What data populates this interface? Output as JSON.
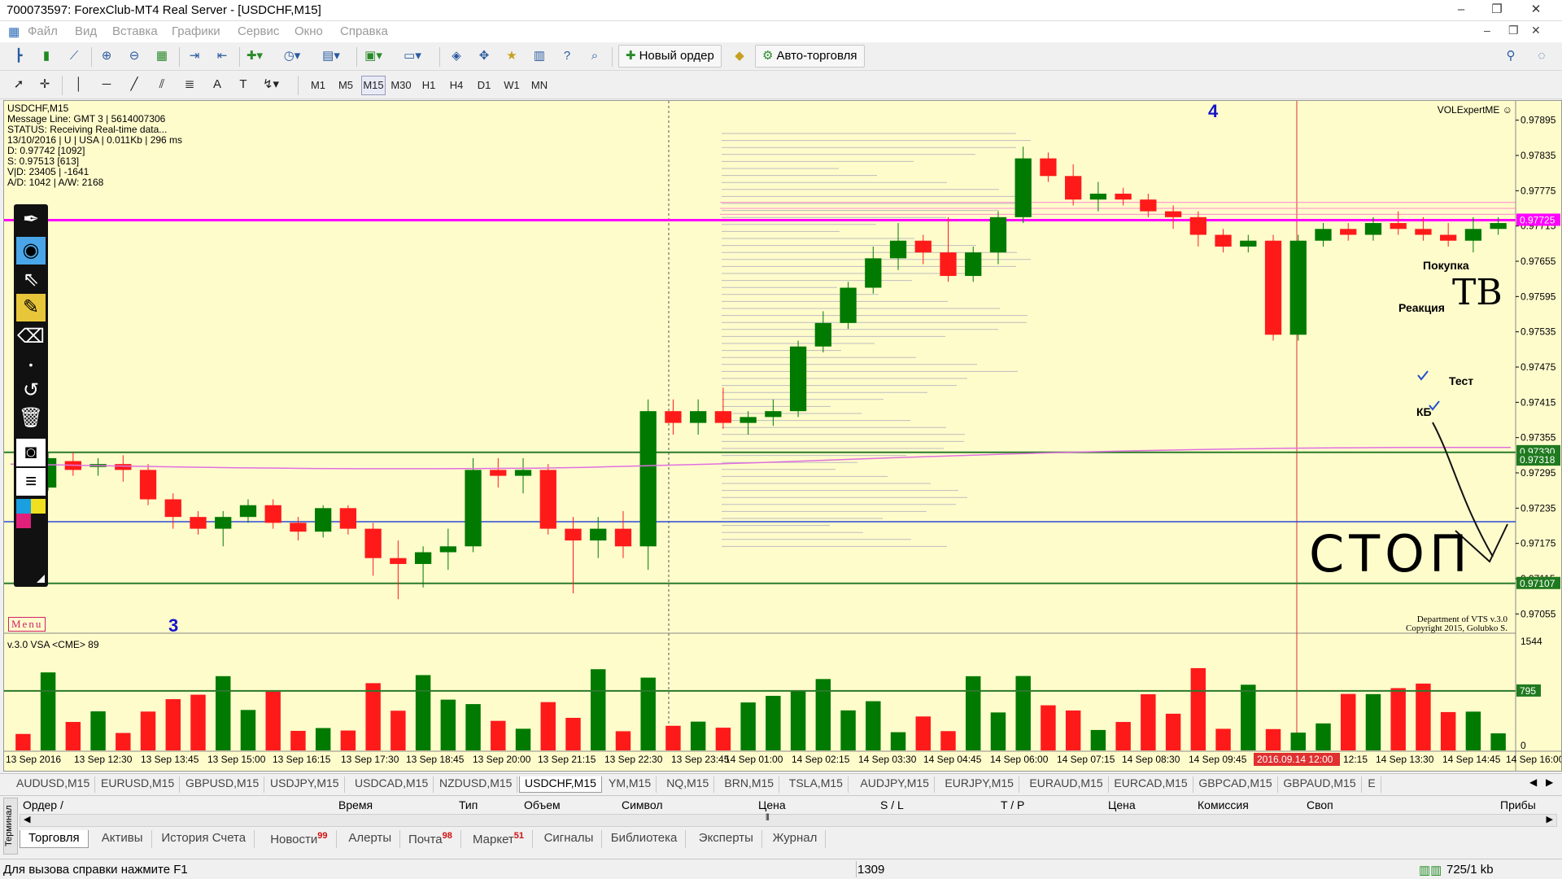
{
  "window": {
    "title": "700073597: ForexClub-MT4 Real Server - [USDCHF,M15]",
    "minimize": "–",
    "restore": "❐",
    "close": "✕"
  },
  "menu": [
    "Файл",
    "Вид",
    "Вставка",
    "Графики",
    "Сервис",
    "Окно",
    "Справка"
  ],
  "toolbar": {
    "new_order": "Новый ордер",
    "auto_trading": "Авто-торговля",
    "timeframes": [
      "M1",
      "M5",
      "M15",
      "M30",
      "H1",
      "H4",
      "D1",
      "W1",
      "MN"
    ],
    "active_timeframe": "M15"
  },
  "chart": {
    "info_lines": [
      "USDCHF,M15",
      "Message Line: GMT 3 | 5614007306",
      "STATUS:  Receiving Real-time data...",
      "13/10/2016 | U | USA | 0.011Kb | 296 ms",
      "D: 0.97742  [1092]",
      "S: 0.97513  [613]",
      "V|D: 23405 | -1641",
      "A/D: 1042 | A/W: 2168"
    ],
    "indicator_name": "VOLExpertME ☺",
    "copyright_1": "Department of VTS  v.3.0",
    "copyright_2": "Copyright 2015, Golubko S.",
    "menu_tag": "Menu",
    "vsa_label": "v.3.0 VSA <CME> 89",
    "wave_3": "3",
    "wave_4": "4",
    "annotations": {
      "buy": "Покупка",
      "reaction": "Реакция",
      "test": "Тест",
      "kb": "КБ",
      "tv": "ТВ",
      "stop": "СТОП"
    },
    "colors": {
      "background": "#fffccc",
      "bull": "#007a00",
      "bear": "#ff1a1a",
      "magenta_level": "#ff00ff",
      "green_level": "#2a7a2a",
      "blue_level": "#2a4ad8",
      "ma": "#e070e0"
    },
    "price_labels": [
      "0.97895",
      "0.97835",
      "0.97775",
      "0.97715",
      "0.97655",
      "0.97595",
      "0.97535",
      "0.97475",
      "0.97415",
      "0.97355",
      "0.97295",
      "0.97235",
      "0.97175",
      "0.97115",
      "0.97055"
    ],
    "level_labels": {
      "magenta": "0.97725",
      "green_top_a": "0.97330",
      "green_top_b": "0.97318",
      "green_bottom": "0.97107"
    },
    "volume_labels": {
      "max": "1544",
      "level": "795",
      "zero": "0"
    },
    "time_labels": [
      "13 Sep 2016",
      "13 Sep 12:30",
      "13 Sep 13:45",
      "13 Sep 15:00",
      "13 Sep 16:15",
      "13 Sep 17:30",
      "13 Sep 18:45",
      "13 Sep 20:00",
      "13 Sep 21:15",
      "13 Sep 22:30",
      "13 Sep 23:45",
      "14 Sep 01:00",
      "14 Sep 02:15",
      "14 Sep 03:30",
      "14 Sep 04:45",
      "14 Sep 06:00",
      "14 Sep 07:15",
      "14 Sep 08:30",
      "14 Sep 09:45",
      "2016.09.14 12:00",
      "12:15",
      "14 Sep 13:30",
      "14 Sep 14:45",
      "14 Sep 16:00"
    ]
  },
  "symbol_tabs": [
    "AUDUSD,M15",
    "EURUSD,M15",
    "GBPUSD,M15",
    "USDJPY,M15",
    "USDCAD,M15",
    "NZDUSD,M15",
    "USDCHF,M15",
    "YM,M15",
    "NQ,M15",
    "BRN,M15",
    "TSLA,M15",
    "AUDJPY,M15",
    "EURJPY,M15",
    "EURAUD,M15",
    "EURCAD,M15",
    "GBPCAD,M15",
    "GBPAUD,M15",
    "E"
  ],
  "active_symbol": "USDCHF,M15",
  "terminal": {
    "side_label": "Терминал",
    "columns": [
      "Ордер  /",
      "Время",
      "Тип",
      "Объем",
      "Символ",
      "Цена",
      "S / L",
      "T / P",
      "Цена",
      "Комиссия",
      "Своп",
      "Прибы"
    ],
    "tabs": [
      {
        "label": "Торговля",
        "badge": ""
      },
      {
        "label": "Активы",
        "badge": ""
      },
      {
        "label": "История Счета",
        "badge": ""
      },
      {
        "label": "Новости",
        "badge": "99"
      },
      {
        "label": "Алерты",
        "badge": ""
      },
      {
        "label": "Почта",
        "badge": "98"
      },
      {
        "label": "Маркет",
        "badge": "51"
      },
      {
        "label": "Сигналы",
        "badge": ""
      },
      {
        "label": "Библиотека",
        "badge": ""
      },
      {
        "label": "Эксперты",
        "badge": ""
      },
      {
        "label": "Журнал",
        "badge": ""
      }
    ]
  },
  "status": {
    "help": "Для вызова справки нажмите F1",
    "number": "1309",
    "traffic": "725/1 kb"
  },
  "chart_data": {
    "type": "candlestick",
    "symbol": "USDCHF",
    "timeframe": "M15",
    "ylim": [
      0.97025,
      0.97925
    ],
    "levels": [
      0.97725,
      0.9733,
      0.97318,
      0.97107
    ],
    "candles": [
      [
        0.97295,
        0.9731,
        0.9726,
        0.9727
      ],
      [
        0.9727,
        0.9733,
        0.97265,
        0.9732
      ],
      [
        0.97315,
        0.9733,
        0.9729,
        0.973
      ],
      [
        0.97305,
        0.9732,
        0.9729,
        0.9731
      ],
      [
        0.9731,
        0.97325,
        0.9728,
        0.973
      ],
      [
        0.973,
        0.9731,
        0.9724,
        0.9725
      ],
      [
        0.9725,
        0.9726,
        0.972,
        0.9722
      ],
      [
        0.9722,
        0.9723,
        0.9719,
        0.972
      ],
      [
        0.972,
        0.9723,
        0.9717,
        0.9722
      ],
      [
        0.9722,
        0.9725,
        0.9721,
        0.9724
      ],
      [
        0.9724,
        0.9725,
        0.972,
        0.9721
      ],
      [
        0.9721,
        0.9722,
        0.9718,
        0.97195
      ],
      [
        0.97195,
        0.9724,
        0.97185,
        0.97235
      ],
      [
        0.97235,
        0.9724,
        0.9719,
        0.972
      ],
      [
        0.972,
        0.9721,
        0.9712,
        0.9715
      ],
      [
        0.9715,
        0.9718,
        0.9708,
        0.9714
      ],
      [
        0.9714,
        0.9717,
        0.971,
        0.9716
      ],
      [
        0.9716,
        0.972,
        0.9713,
        0.9717
      ],
      [
        0.9717,
        0.9732,
        0.9716,
        0.973
      ],
      [
        0.973,
        0.9732,
        0.9727,
        0.9729
      ],
      [
        0.9729,
        0.9732,
        0.9726,
        0.973
      ],
      [
        0.973,
        0.9731,
        0.9719,
        0.972
      ],
      [
        0.972,
        0.9722,
        0.9709,
        0.9718
      ],
      [
        0.9718,
        0.9722,
        0.9715,
        0.972
      ],
      [
        0.972,
        0.9723,
        0.9715,
        0.9717
      ],
      [
        0.9717,
        0.9742,
        0.9713,
        0.974
      ],
      [
        0.974,
        0.9742,
        0.9736,
        0.9738
      ],
      [
        0.9738,
        0.9742,
        0.9736,
        0.974
      ],
      [
        0.974,
        0.9744,
        0.9737,
        0.9738
      ],
      [
        0.9738,
        0.974,
        0.9736,
        0.9739
      ],
      [
        0.9739,
        0.9742,
        0.97375,
        0.974
      ],
      [
        0.974,
        0.9752,
        0.9739,
        0.9751
      ],
      [
        0.9751,
        0.9757,
        0.975,
        0.9755
      ],
      [
        0.9755,
        0.9762,
        0.9754,
        0.9761
      ],
      [
        0.9761,
        0.9768,
        0.976,
        0.9766
      ],
      [
        0.9766,
        0.9772,
        0.9764,
        0.9769
      ],
      [
        0.9769,
        0.977,
        0.9765,
        0.9767
      ],
      [
        0.9767,
        0.9773,
        0.9762,
        0.9763
      ],
      [
        0.9763,
        0.9768,
        0.9762,
        0.9767
      ],
      [
        0.9767,
        0.9774,
        0.9765,
        0.9773
      ],
      [
        0.9773,
        0.9785,
        0.9772,
        0.9783
      ],
      [
        0.9783,
        0.9784,
        0.9779,
        0.978
      ],
      [
        0.978,
        0.9782,
        0.9775,
        0.9776
      ],
      [
        0.9776,
        0.9779,
        0.9774,
        0.9777
      ],
      [
        0.9777,
        0.9778,
        0.9775,
        0.9776
      ],
      [
        0.9776,
        0.9777,
        0.9773,
        0.9774
      ],
      [
        0.9774,
        0.9775,
        0.9771,
        0.9773
      ],
      [
        0.9773,
        0.9774,
        0.9768,
        0.977
      ],
      [
        0.977,
        0.9771,
        0.9767,
        0.9768
      ],
      [
        0.9768,
        0.977,
        0.9767,
        0.9769
      ],
      [
        0.9769,
        0.977,
        0.9752,
        0.9753
      ],
      [
        0.9753,
        0.977,
        0.9752,
        0.9769
      ],
      [
        0.9769,
        0.9772,
        0.9768,
        0.9771
      ],
      [
        0.9771,
        0.9772,
        0.9769,
        0.977
      ],
      [
        0.977,
        0.9773,
        0.9769,
        0.9772
      ],
      [
        0.9772,
        0.9774,
        0.977,
        0.9771
      ],
      [
        0.9771,
        0.9773,
        0.9769,
        0.977
      ],
      [
        0.977,
        0.9772,
        0.9768,
        0.9769
      ],
      [
        0.9769,
        0.9773,
        0.9767,
        0.9771
      ],
      [
        0.9771,
        0.9773,
        0.977,
        0.9772
      ]
    ],
    "volume_levels": [
      795
    ],
    "ylim_volume": [
      0,
      1544
    ]
  }
}
